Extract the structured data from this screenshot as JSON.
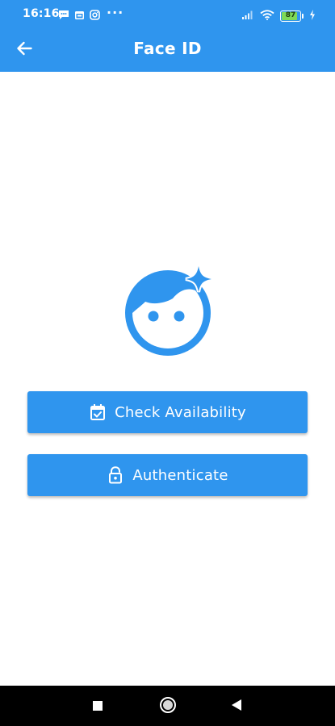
{
  "status_bar": {
    "time": "16:16",
    "left_icons": [
      "message-icon",
      "calendar-icon",
      "instagram-icon"
    ],
    "more": "···",
    "battery_level": "87",
    "right_icons": [
      "signal-icon",
      "wifi-icon",
      "battery-icon",
      "charging-icon"
    ]
  },
  "app_bar": {
    "back_icon": "arrow-left-icon",
    "title": "Face ID"
  },
  "main": {
    "face_icon": "face-retouching-icon",
    "buttons": [
      {
        "label": "Check Availability",
        "icon": "calendar-check-icon"
      },
      {
        "label": "Authenticate",
        "icon": "lock-open-icon"
      }
    ]
  },
  "nav_bar": {
    "items": [
      "recents-button",
      "home-button",
      "back-button"
    ]
  },
  "colors": {
    "primary": "#2f95ee",
    "background": "#ffffff",
    "nav_bar": "#000000",
    "battery_fill": "#7ed957"
  }
}
